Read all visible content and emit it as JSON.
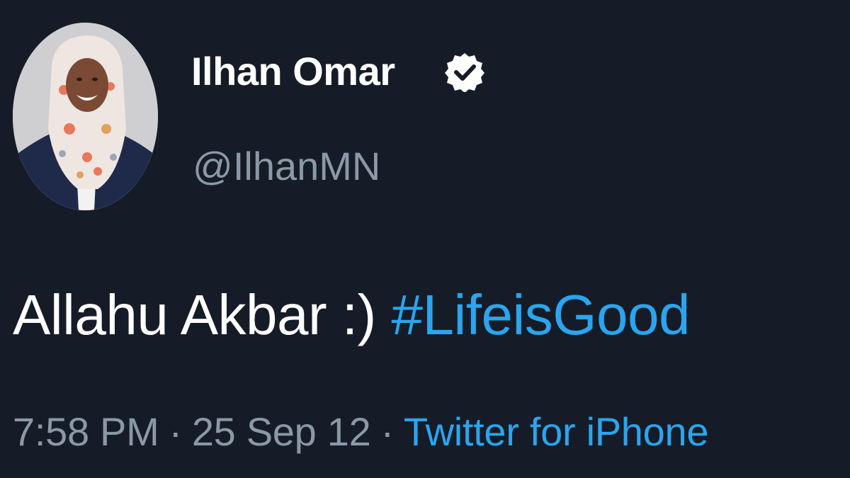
{
  "user": {
    "display_name": "Ilhan Omar",
    "handle": "@IlhanMN",
    "verified": true,
    "verified_icon": "verified-badge-icon",
    "avatar_icon": "profile-photo"
  },
  "tweet": {
    "text_plain": "Allahu Akbar :)",
    "hashtag": "#LifeisGood"
  },
  "meta": {
    "time": "7:58 PM",
    "separator": "·",
    "date": "25 Sep 12",
    "source": "Twitter for iPhone"
  },
  "colors": {
    "background": "#161c27",
    "name": "#ffffff",
    "secondary_text": "#8b98a6",
    "link": "#2aa5ee"
  }
}
